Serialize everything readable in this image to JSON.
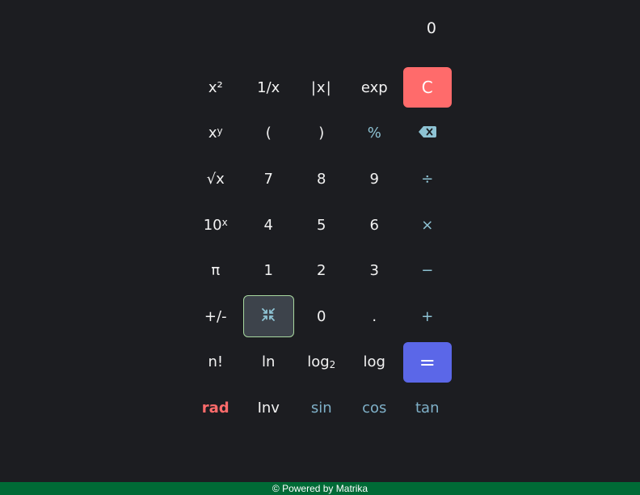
{
  "display": {
    "value": "0"
  },
  "keys": {
    "square": {
      "base": "x",
      "sup": "²"
    },
    "reciprocal": "1/x",
    "abs": "|x|",
    "exp": "exp",
    "clear": "C",
    "power": {
      "base": "x",
      "sup": "y"
    },
    "open_paren": "(",
    "close_paren": ")",
    "percent": "%",
    "sqrt": "√x",
    "seven": "7",
    "eight": "8",
    "nine": "9",
    "divide": "÷",
    "ten_power": {
      "base": "10",
      "sup": "x"
    },
    "four": "4",
    "five": "5",
    "six": "6",
    "multiply": "×",
    "pi": "π",
    "one": "1",
    "two": "2",
    "three": "3",
    "minus": "−",
    "negate": "+/-",
    "zero": "0",
    "decimal": ".",
    "plus": "+",
    "factorial": "n!",
    "ln": "ln",
    "log2": {
      "base": "log",
      "sub": "2"
    },
    "log": "log",
    "equals": "=",
    "rad": "rad",
    "inv": "Inv",
    "sin": "sin",
    "cos": "cos",
    "tan": "tan"
  },
  "icons": {
    "backspace": "backspace-icon",
    "collapse": "collapse-icon"
  },
  "colors": {
    "background": "#1c1d21",
    "clear": "#ff6b6b",
    "equals": "#5b67e8",
    "operator": "#8ec3d4",
    "rad": "#ff6b6b",
    "footer": "#006a36"
  },
  "footer": {
    "text": "© Powered by Matrika"
  }
}
